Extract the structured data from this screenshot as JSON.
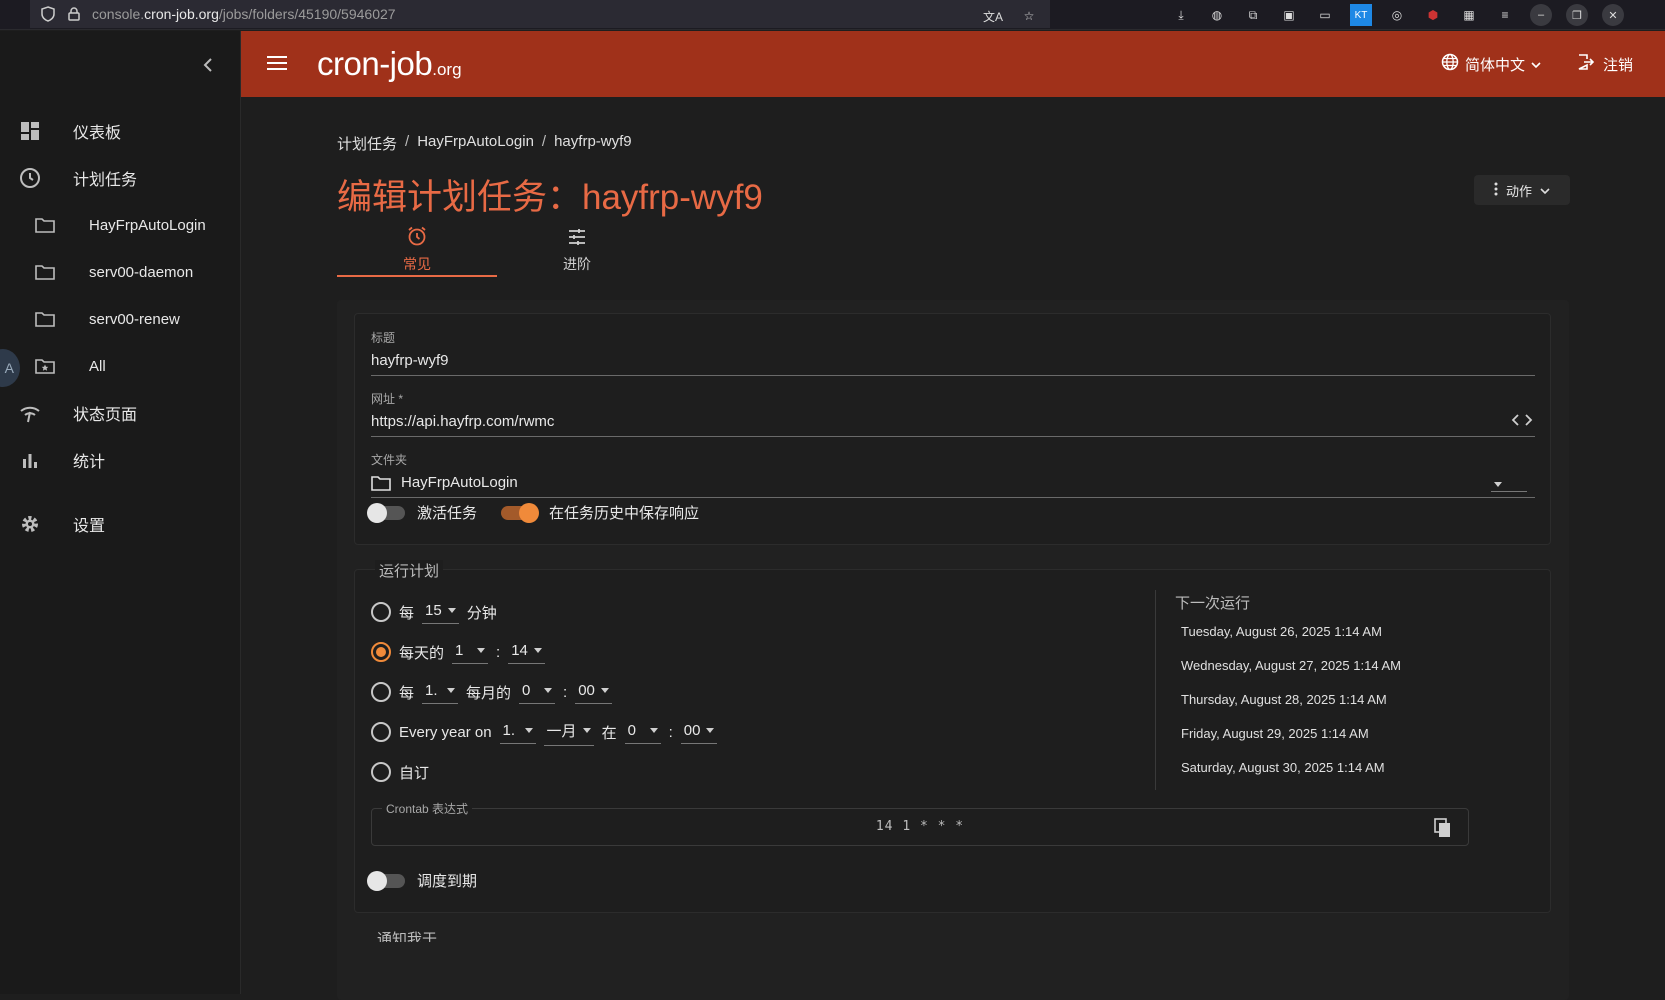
{
  "browser": {
    "url_prefix": "console.",
    "url_domain": "cron-job.org",
    "url_path": "/jobs/folders/45190/5946027"
  },
  "sidebar": {
    "items": [
      {
        "label": "仪表板",
        "icon": "dashboard-icon"
      },
      {
        "label": "计划任务",
        "icon": "clock-icon"
      },
      {
        "label": "HayFrpAutoLogin",
        "icon": "folder-icon"
      },
      {
        "label": "serv00-daemon",
        "icon": "folder-icon"
      },
      {
        "label": "serv00-renew",
        "icon": "folder-icon"
      },
      {
        "label": "All",
        "icon": "folder-star-icon"
      },
      {
        "label": "状态页面",
        "icon": "signal-icon"
      },
      {
        "label": "统计",
        "icon": "bar-chart-icon"
      },
      {
        "label": "设置",
        "icon": "gear-icon"
      }
    ],
    "bubble": "A"
  },
  "topbar": {
    "logo_main": "cron-job",
    "logo_suffix": ".org",
    "language": "简体中文",
    "logout": "注销"
  },
  "breadcrumb": [
    "计划任务",
    "HayFrpAutoLogin",
    "hayfrp-wyf9"
  ],
  "page_title": "编辑计划任务：hayfrp-wyf9",
  "actions_label": "动作",
  "tabs": [
    {
      "label": "常见",
      "icon": "alarm-icon",
      "active": true
    },
    {
      "label": "进阶",
      "icon": "tune-icon",
      "active": false
    }
  ],
  "form": {
    "title_label": "标题",
    "title_value": "hayfrp-wyf9",
    "url_label": "网址 *",
    "url_value": "https://api.hayfrp.com/rwmc",
    "folder_label": "文件夹",
    "folder_value": "HayFrpAutoLogin",
    "activate_label": "激活任务",
    "activate_on": false,
    "save_response_label": "在任务历史中保存响应",
    "save_response_on": true
  },
  "schedule": {
    "legend": "运行计划",
    "every": "每",
    "minutes_value": "15",
    "minutes_unit": "分钟",
    "daily_label": "每天的",
    "daily_hour": "1",
    "colon": ":",
    "daily_minute": "14",
    "monthly_every": "每",
    "monthly_day": "1.",
    "monthly_label": "每月的",
    "monthly_hour": "0",
    "monthly_minute": "00",
    "yearly_label": "Every year on",
    "yearly_day": "1.",
    "yearly_month": "一月",
    "yearly_at": "在",
    "yearly_hour": "0",
    "yearly_minute": "00",
    "custom_label": "自订",
    "selected": "daily",
    "next_title": "下一次运行",
    "next_runs": [
      "Tuesday, August 26, 2025 1:14 AM",
      "Wednesday, August 27, 2025 1:14 AM",
      "Thursday, August 28, 2025 1:14 AM",
      "Friday, August 29, 2025 1:14 AM",
      "Saturday, August 30, 2025 1:14 AM"
    ],
    "crontab_label": "Crontab 表达式",
    "crontab_value": "14 1 * * *",
    "expire_label": "调度到期",
    "expire_on": false
  },
  "next_section_partial": "通知我于"
}
